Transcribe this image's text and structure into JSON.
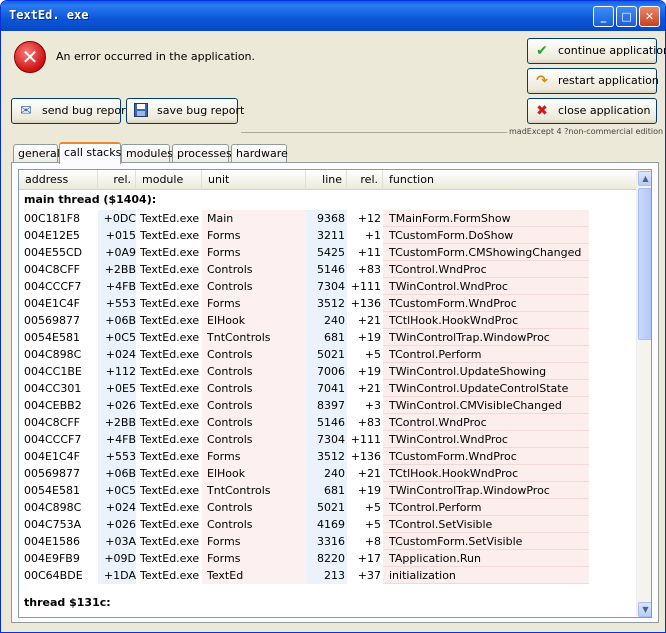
{
  "window": {
    "title": "TextEd. exe",
    "min": "_",
    "max": "□",
    "close": "✕"
  },
  "error": {
    "icon": "error-x-icon",
    "glyph": "✕",
    "message": "An error occurred in the application."
  },
  "buttons": {
    "continue": "continue application",
    "restart": "restart application",
    "close": "close application",
    "send": "send bug report",
    "save": "save bug report"
  },
  "madexcept_label": "madExcept 4 ?non-commercial edition",
  "tabs": [
    "general",
    "call stacks",
    "modules",
    "processes",
    "hardware"
  ],
  "active_tab": "call stacks",
  "columns": [
    "address",
    "rel.",
    "module",
    "unit",
    "line",
    "rel.",
    "function"
  ],
  "threads": [
    {
      "label": "main thread ($1404):",
      "rows": [
        [
          "00C181F8",
          "+0DC",
          "TextEd.exe",
          "Main",
          "9368",
          "+12",
          "TMainForm.FormShow"
        ],
        [
          "004E12E5",
          "+015",
          "TextEd.exe",
          "Forms",
          "3211",
          "+1",
          "TCustomForm.DoShow"
        ],
        [
          "004E55CD",
          "+0A9",
          "TextEd.exe",
          "Forms",
          "5425",
          "+11",
          "TCustomForm.CMShowingChanged"
        ],
        [
          "004C8CFF",
          "+2BB",
          "TextEd.exe",
          "Controls",
          "5146",
          "+83",
          "TControl.WndProc"
        ],
        [
          "004CCCF7",
          "+4FB",
          "TextEd.exe",
          "Controls",
          "7304",
          "+111",
          "TWinControl.WndProc"
        ],
        [
          "004E1C4F",
          "+553",
          "TextEd.exe",
          "Forms",
          "3512",
          "+136",
          "TCustomForm.WndProc"
        ],
        [
          "00569877",
          "+06B",
          "TextEd.exe",
          "ElHook",
          "240",
          "+21",
          "TCtlHook.HookWndProc"
        ],
        [
          "0054E581",
          "+0C5",
          "TextEd.exe",
          "TntControls",
          "681",
          "+19",
          "TWinControlTrap.WindowProc"
        ],
        [
          "004C898C",
          "+024",
          "TextEd.exe",
          "Controls",
          "5021",
          "+5",
          "TControl.Perform"
        ],
        [
          "004CC1BE",
          "+112",
          "TextEd.exe",
          "Controls",
          "7006",
          "+19",
          "TWinControl.UpdateShowing"
        ],
        [
          "004CC301",
          "+0E5",
          "TextEd.exe",
          "Controls",
          "7041",
          "+21",
          "TWinControl.UpdateControlState"
        ],
        [
          "004CEBB2",
          "+026",
          "TextEd.exe",
          "Controls",
          "8397",
          "+3",
          "TWinControl.CMVisibleChanged"
        ],
        [
          "004C8CFF",
          "+2BB",
          "TextEd.exe",
          "Controls",
          "5146",
          "+83",
          "TControl.WndProc"
        ],
        [
          "004CCCF7",
          "+4FB",
          "TextEd.exe",
          "Controls",
          "7304",
          "+111",
          "TWinControl.WndProc"
        ],
        [
          "004E1C4F",
          "+553",
          "TextEd.exe",
          "Forms",
          "3512",
          "+136",
          "TCustomForm.WndProc"
        ],
        [
          "00569877",
          "+06B",
          "TextEd.exe",
          "ElHook",
          "240",
          "+21",
          "TCtlHook.HookWndProc"
        ],
        [
          "0054E581",
          "+0C5",
          "TextEd.exe",
          "TntControls",
          "681",
          "+19",
          "TWinControlTrap.WindowProc"
        ],
        [
          "004C898C",
          "+024",
          "TextEd.exe",
          "Controls",
          "5021",
          "+5",
          "TControl.Perform"
        ],
        [
          "004C753A",
          "+026",
          "TextEd.exe",
          "Controls",
          "4169",
          "+5",
          "TControl.SetVisible"
        ],
        [
          "004E1586",
          "+03A",
          "TextEd.exe",
          "Forms",
          "3316",
          "+8",
          "TCustomForm.SetVisible"
        ],
        [
          "004E9FB9",
          "+09D",
          "TextEd.exe",
          "Forms",
          "8220",
          "+17",
          "TApplication.Run"
        ],
        [
          "00C64BDE",
          "+1DA",
          "TextEd.exe",
          "TextEd",
          "213",
          "+37",
          "initialization"
        ]
      ]
    },
    {
      "label": "thread $131c:",
      "rows": []
    }
  ],
  "scrollbar": {
    "up": "▲",
    "down": "▼"
  }
}
